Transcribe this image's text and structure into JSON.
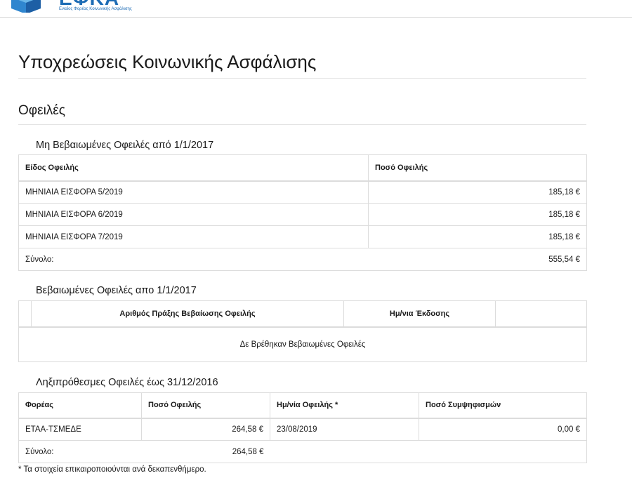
{
  "header": {
    "logo_text": "ΕΦΚΑ",
    "logo_subtitle": "Ενιαίος Φορέας Κοινωνικής Ασφάλισης"
  },
  "page": {
    "title": "Υποχρεώσεις Κοινωνικής Ασφάλισης",
    "section_title": "Οφειλές"
  },
  "unconfirmed": {
    "title": "Μη Βεβαιωμένες Οφειλές από 1/1/2017",
    "columns": [
      "Είδος Οφειλής",
      "Ποσό Οφειλής"
    ],
    "rows": [
      {
        "type": "ΜΗΝΙΑΙΑ ΕΙΣΦΟΡΑ 5/2019",
        "amount": "185,18 €"
      },
      {
        "type": "ΜΗΝΙΑΙΑ ΕΙΣΦΟΡΑ 6/2019",
        "amount": "185,18 €"
      },
      {
        "type": "ΜΗΝΙΑΙΑ ΕΙΣΦΟΡΑ 7/2019",
        "amount": "185,18 €"
      }
    ],
    "total_label": "Σύνολο:",
    "total_value": "555,54 €"
  },
  "confirmed": {
    "title": "Βεβαιωμένες Οφειλές απο 1/1/2017",
    "columns": [
      "Αριθμός Πράξης Βεβαίωσης Οφειλής",
      "Ημ/νια Έκδοσης"
    ],
    "empty_message": "Δε Βρέθηκαν Βεβαιωμένες Οφειλές"
  },
  "overdue": {
    "title": "Ληξιπρόθεσμες Οφειλές έως 31/12/2016",
    "columns": [
      "Φορέας",
      "Ποσό Οφειλής",
      "Ημ/νία Οφειλής *",
      "Ποσό Συμψηφισμών"
    ],
    "rows": [
      {
        "agency": "ΕΤΑΑ-ΤΣΜΕΔΕ",
        "amount": "264,58 €",
        "date": "23/08/2019",
        "offset": "0,00 €"
      }
    ],
    "total_label": "Σύνολο:",
    "total_value": "264,58 €"
  },
  "footnote": "* Τα στοιχεία επικαιροποιούνται ανά δεκαπενθήμερο.",
  "colors": {
    "brand": "#1d6cb5",
    "border": "#dcdcdc"
  }
}
